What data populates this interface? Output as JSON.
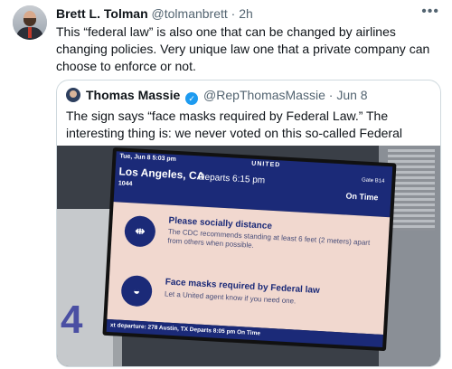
{
  "tweet": {
    "author_name": "Brett L. Tolman",
    "handle": "@tolmanbrett",
    "separator": "·",
    "time": "2h",
    "more_icon": "more-icon",
    "text": "This “federal law” is also one that can be changed by airlines changing policies. Very unique law one that a private company can choose to enforce or not."
  },
  "quoted": {
    "author_name": "Thomas Massie",
    "verified_icon": "verified-badge-icon",
    "handle": "@RepThomasMassie",
    "separator": "·",
    "date": "Jun 8",
    "text": "The sign says “face masks required by Federal Law.” The interesting thing is: we never voted on this so-called Federal Law."
  },
  "photo": {
    "screen": {
      "date_time": "Tue, Jun 8  5:03 pm",
      "brand": "UNITED",
      "destination": "Los Angeles, CA",
      "departs": "Departs 6:15 pm",
      "gate": "Gate B14",
      "flight": "1044",
      "status": "On Time",
      "notice1_title": "Please socially distance",
      "notice1_text": "The CDC recommends standing at least 6 feet (2 meters) apart from others when possible.",
      "notice2_title": "Face masks required by Federal law",
      "notice2_text": "Let a United agent know if you need one.",
      "next_departure": "xt departure:  278   Austin, TX   Departs 8:05 pm   On Time"
    },
    "gate_number": "4"
  },
  "colors": {
    "united_blue": "#1b2a78",
    "verified_blue": "#1d9bf0",
    "screen_bg": "#f1d8cf"
  }
}
